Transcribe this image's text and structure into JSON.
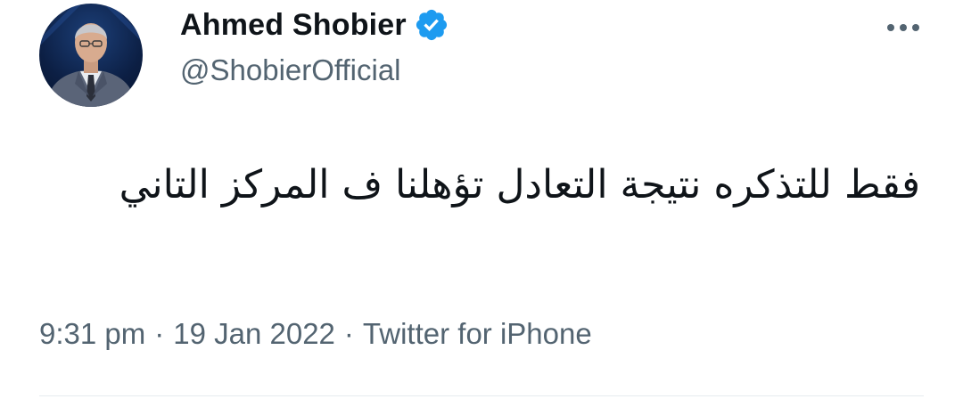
{
  "author": {
    "display_name": "Ahmed Shobier",
    "handle": "@ShobierOfficial",
    "avatar_icon": "profile-photo",
    "verified_icon": "verified-badge-icon",
    "verified_color": "#1d9bf0"
  },
  "more_icon": "more-dots-icon",
  "tweet": {
    "text": "فقط للتذكره نتيجة التعادل تؤهلنا ف المركز التاني"
  },
  "meta": {
    "time": "9:31 pm",
    "separator": "·",
    "date": "19 Jan 2022",
    "source": "Twitter for iPhone"
  },
  "colors": {
    "text_primary": "#0f1419",
    "text_secondary": "#536471",
    "divider": "#e6ecf0"
  }
}
